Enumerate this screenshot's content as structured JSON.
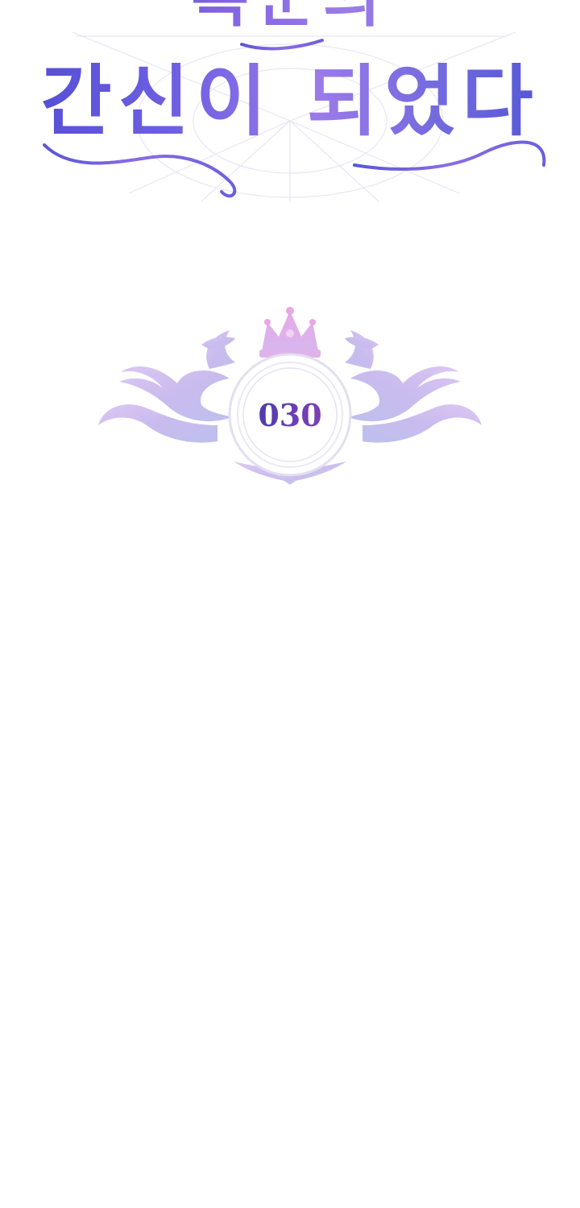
{
  "title": {
    "line1": "복군의",
    "line2": "간신이 되었다"
  },
  "chapter": {
    "number": "030"
  },
  "colors": {
    "title_primary": "#5b53d6",
    "title_accent": "#9b7ce8",
    "emblem_tint": "#c9bdf0",
    "number_color": "#4a3db0",
    "background": "#ffffff"
  },
  "icons": {
    "emblem": "crown-ornament-frame-icon",
    "title_flourish": "title-flourish-icon"
  }
}
